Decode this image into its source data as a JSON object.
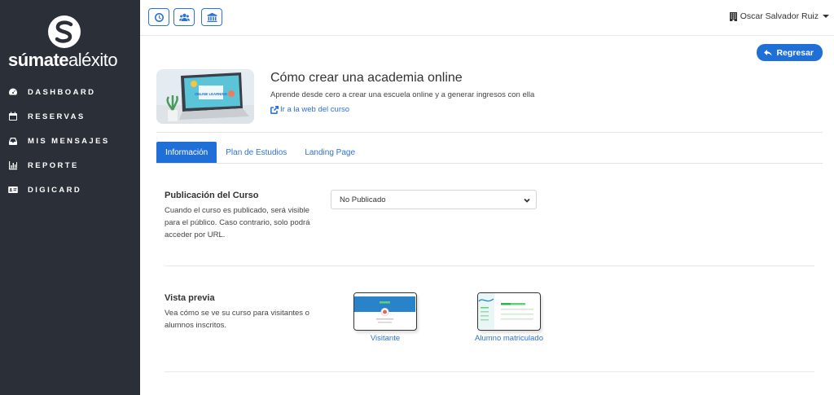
{
  "sidebar": {
    "logo_bold": "súmate",
    "logo_light": "aléxito",
    "items": [
      {
        "label": "DASHBOARD",
        "icon": "dashboard-icon"
      },
      {
        "label": "RESERVAS",
        "icon": "calendar-icon"
      },
      {
        "label": "MIS MENSAJES",
        "icon": "inbox-icon"
      },
      {
        "label": "REPORTE",
        "icon": "chart-icon"
      },
      {
        "label": "DIGICARD",
        "icon": "id-card-icon"
      }
    ]
  },
  "topbar": {
    "buttons": [
      {
        "icon": "clock-icon"
      },
      {
        "icon": "users-icon"
      },
      {
        "icon": "bank-icon"
      }
    ],
    "user_name": "Oscar Salvador Ruiz"
  },
  "main": {
    "back_label": "Regresar",
    "course": {
      "image_text": "ONLINE LEARNING",
      "title": "Cómo crear una academia online",
      "subtitle": "Aprende desde cero a crear una escuela online y a generar ingresos con ella",
      "link": "Ir a la web del curso"
    },
    "tabs": [
      {
        "label": "Información",
        "active": true
      },
      {
        "label": "Plan de Estudios",
        "active": false
      },
      {
        "label": "Landing Page",
        "active": false
      }
    ],
    "publication": {
      "title": "Publicación del Curso",
      "desc": "Cuando el curso es publicado, será visible para el público. Caso contrario, solo podrá acceder por URL.",
      "select_value": "No Publicado"
    },
    "preview": {
      "title": "Vista previa",
      "desc": "Vea cómo se ve su curso para visitantes o alumnos inscritos.",
      "visitor_label": "Visitante",
      "student_label": "Alumno matriculado"
    }
  },
  "colors": {
    "sidebar_bg": "#2b3038",
    "accent": "#1f6fd6"
  }
}
